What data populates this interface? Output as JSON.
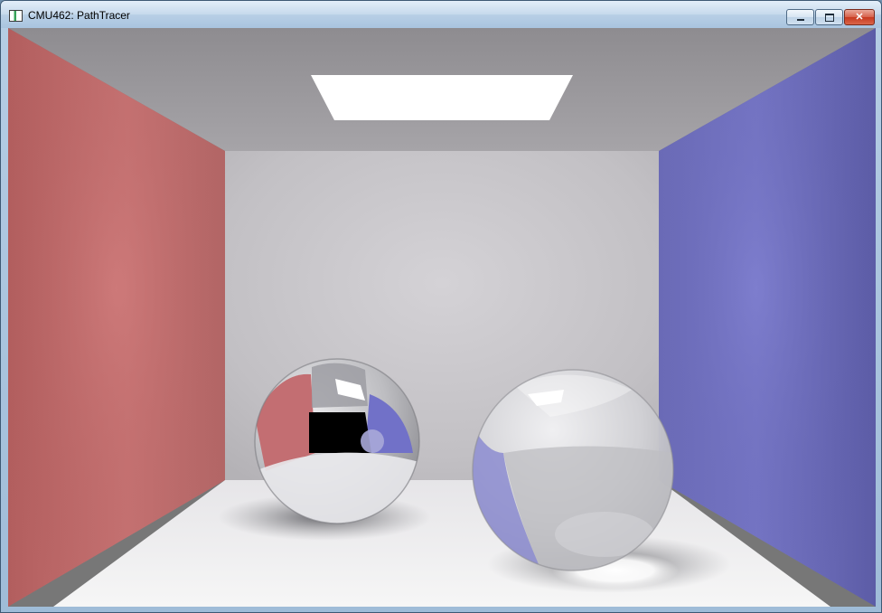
{
  "window": {
    "title": "CMU462: PathTracer",
    "minimize_glyph": "minimize-icon",
    "maximize_glyph": "maximize-icon",
    "close_glyph": "close-icon",
    "close_label": "✕"
  },
  "scene": {
    "description_icon": "rendered-scene",
    "left_wall_color": "#c06a6a",
    "right_wall_color": "#7070c0",
    "back_wall_color": "#c9c7cb",
    "floor_color": "#f2f2f2",
    "ceiling_color": "#9a989c",
    "light_color": "#ffffff"
  }
}
